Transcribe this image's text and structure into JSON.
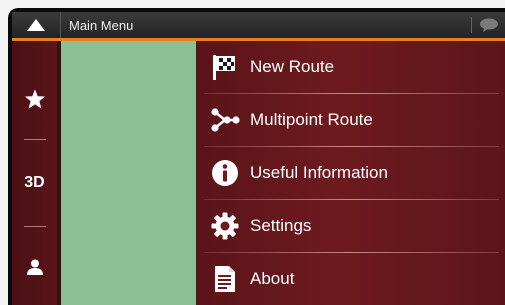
{
  "header": {
    "title": "Main Menu"
  },
  "sidebar": {
    "buttons": [
      {
        "name": "favorites",
        "icon": "star-icon"
      },
      {
        "name": "view-mode",
        "label": "3D"
      },
      {
        "name": "profile",
        "icon": "user-icon"
      }
    ]
  },
  "menu": {
    "items": [
      {
        "label": "New Route",
        "icon": "checkered-flag-icon"
      },
      {
        "label": "Multipoint Route",
        "icon": "multipoint-route-icon"
      },
      {
        "label": "Useful Information",
        "icon": "info-icon"
      },
      {
        "label": "Settings",
        "icon": "gear-icon"
      },
      {
        "label": "About",
        "icon": "document-icon"
      }
    ]
  },
  "colors": {
    "accent": "#ec7d22",
    "menu_bg": "#6d1a1f",
    "map": "#8cbf93",
    "topbar": "#2a2a2a"
  }
}
